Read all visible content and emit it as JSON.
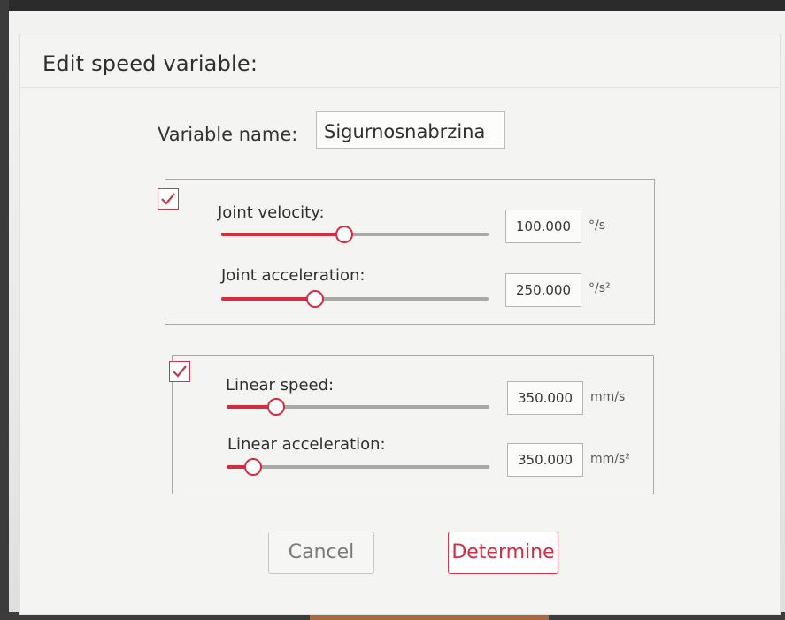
{
  "dialog": {
    "title": "Edit speed variable:",
    "variable_name_label": "Variable name:",
    "variable_name_value": "Sigurnosnabrzina"
  },
  "joint_group": {
    "enabled": true,
    "velocity": {
      "label": "Joint velocity:",
      "value": "100.000",
      "unit": "°/s",
      "slider_fraction": 0.46
    },
    "acceleration": {
      "label": "Joint acceleration:",
      "value": "250.000",
      "unit": "°/s²",
      "slider_fraction": 0.35
    }
  },
  "linear_group": {
    "enabled": true,
    "speed": {
      "label": "Linear speed:",
      "value": "350.000",
      "unit": "mm/s",
      "slider_fraction": 0.19
    },
    "acceleration": {
      "label": "Linear acceleration:",
      "value": "350.000",
      "unit": "mm/s²",
      "slider_fraction": 0.1
    }
  },
  "buttons": {
    "cancel": "Cancel",
    "determine": "Determine"
  },
  "colors": {
    "accent": "#d42d40",
    "track": "#a8a8a8"
  }
}
